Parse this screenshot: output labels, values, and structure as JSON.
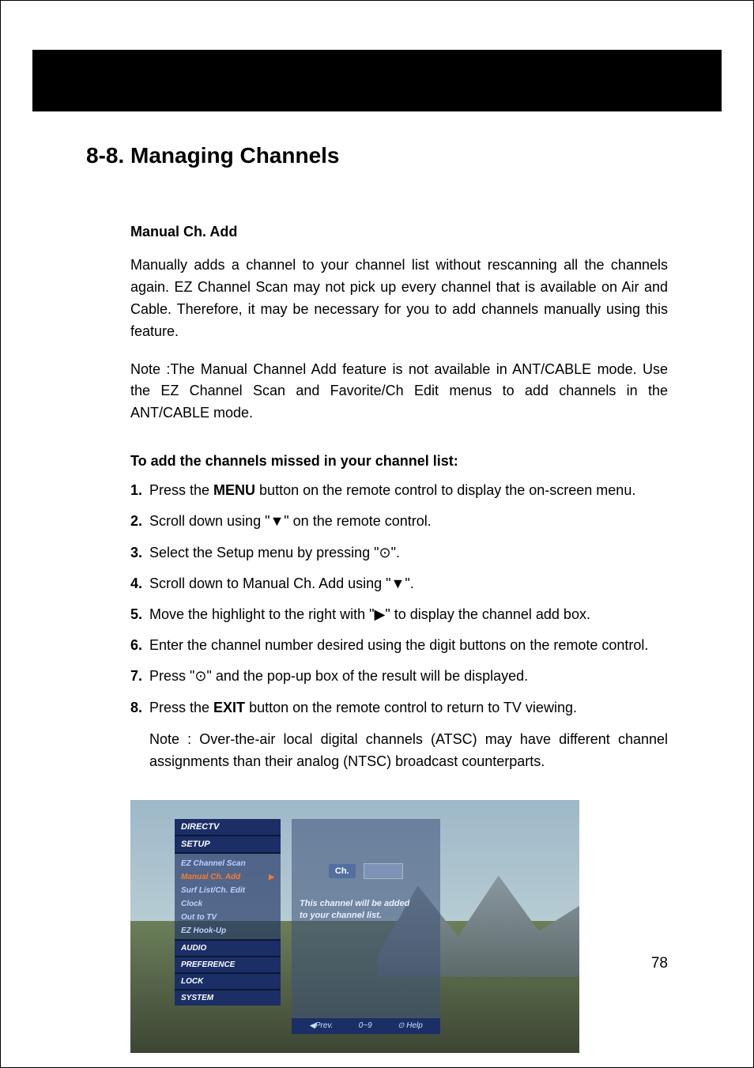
{
  "section_title": "8-8. Managing Channels",
  "sub1_title": "Manual Ch. Add",
  "para1": "Manually adds a channel to your channel list without rescanning all the channels again. EZ Channel Scan may not pick up every channel that is available on Air and Cable. Therefore, it may be necessary for you to add channels manually using this feature.",
  "para2": "Note :The Manual Channel Add feature is not available in ANT/CABLE mode. Use the EZ Channel Scan and Favorite/Ch Edit menus to add channels in the ANT/CABLE mode.",
  "steps_title": "To add the channels missed in your channel list:",
  "steps": [
    {
      "n": "1.",
      "pre": "Press the ",
      "bold": "MENU",
      "post": " button on the remote control to display the on-screen menu."
    },
    {
      "n": "2.",
      "pre": "Scroll down using \"▼\" on the remote control.",
      "bold": "",
      "post": ""
    },
    {
      "n": "3.",
      "pre": "Select the Setup menu by pressing \"⊙\".",
      "bold": "",
      "post": ""
    },
    {
      "n": "4.",
      "pre": "Scroll down to Manual Ch. Add using \"▼\".",
      "bold": "",
      "post": ""
    },
    {
      "n": "5.",
      "pre": "Move the highlight to the right with \"▶\" to display the channel add box.",
      "bold": "",
      "post": ""
    },
    {
      "n": "6.",
      "pre": "Enter the channel number desired using the digit buttons on the remote control.",
      "bold": "",
      "post": ""
    },
    {
      "n": "7.",
      "pre": "Press \"⊙\" and the pop-up box of the result will be displayed.",
      "bold": "",
      "post": ""
    },
    {
      "n": "8.",
      "pre": "Press the ",
      "bold": "EXIT",
      "post": " button on the remote control to return to TV viewing."
    }
  ],
  "step_note": "Note : Over-the-air local digital channels (ATSC) may have different channel assignments than their analog (NTSC) broadcast counterparts.",
  "tv": {
    "brand": "DIRECTV",
    "active_cat": "SETUP",
    "items": [
      "EZ Channel Scan",
      "Manual Ch. Add",
      "Surf List/Ch. Edit",
      "Clock",
      "Out to TV",
      "EZ Hook-Up"
    ],
    "selected_index": 1,
    "other_cats": [
      "AUDIO",
      "PREFERENCE",
      "LOCK",
      "SYSTEM"
    ],
    "ch_label": "Ch.",
    "msg1": "This channel will be added",
    "msg2": "to your channel list.",
    "footer": [
      "◀Prev.",
      "0~9",
      "⊙ Help"
    ]
  },
  "page_number": "78"
}
